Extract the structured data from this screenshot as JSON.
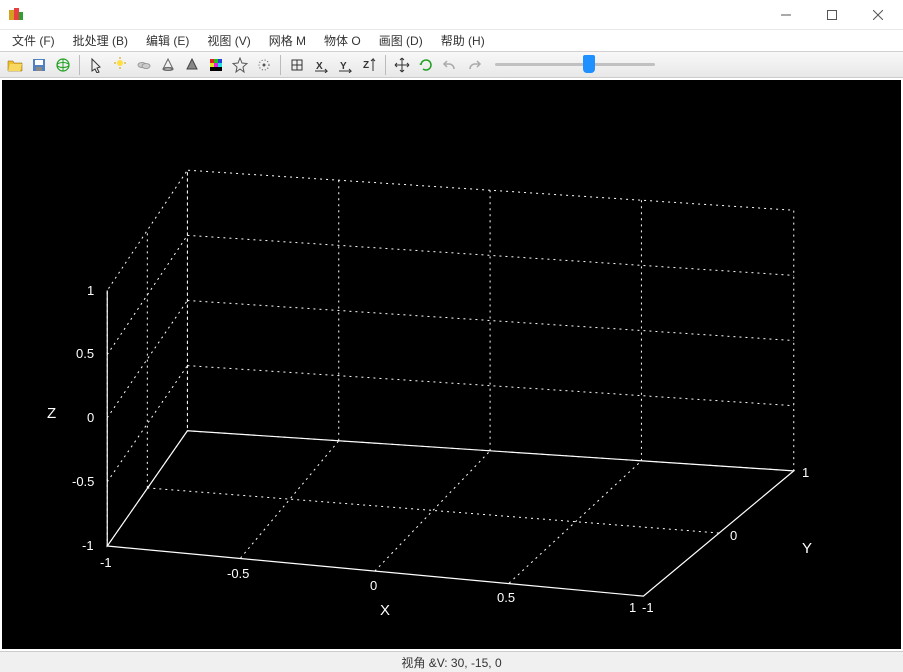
{
  "window": {
    "title": ""
  },
  "menu": {
    "file": "文件 (F)",
    "batch": "批处理 (B)",
    "edit": "编辑 (E)",
    "view": "视图 (V)",
    "grid": "网格 M",
    "object": "物体 O",
    "draw": "画图 (D)",
    "help": "帮助 (H)"
  },
  "toolbar": {
    "open": "open",
    "save": "save",
    "globe": "globe",
    "cursor": "cursor",
    "light": "light",
    "fog": "fog",
    "cone": "cone",
    "shade": "shade",
    "palette": "palette",
    "star": "star",
    "settings": "settings",
    "box": "box",
    "axisx": "X",
    "axisy": "Y",
    "axisz": "Z",
    "updown": "updown",
    "move": "move",
    "rotate": "rotate",
    "undo": "undo",
    "redo": "redo"
  },
  "status": {
    "text": "视角 &V: 30, -15, 0"
  },
  "chart_data": {
    "type": "3d-axes",
    "title": "",
    "x": {
      "label": "X",
      "range": [
        -1,
        1
      ],
      "ticks": [
        -1,
        -0.5,
        0,
        0.5,
        1
      ]
    },
    "y": {
      "label": "Y",
      "range": [
        -1,
        1
      ],
      "ticks": [
        -1,
        0,
        1
      ]
    },
    "z": {
      "label": "Z",
      "range": [
        -1,
        1
      ],
      "ticks": [
        -1,
        -0.5,
        0,
        0.5,
        1
      ]
    },
    "view_angle": [
      30,
      -15,
      0
    ],
    "background": "#000000",
    "axis_color": "#ffffff",
    "series": []
  }
}
